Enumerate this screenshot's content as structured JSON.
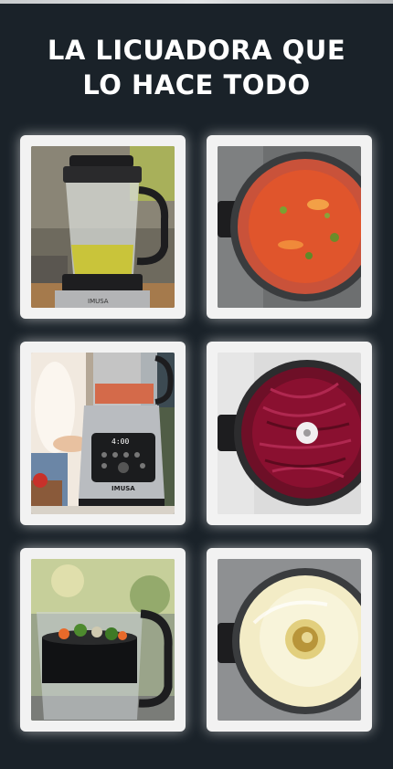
{
  "header": {
    "title_line1": "LA LICUADORA QUE",
    "title_line2": "LO HACE TODO"
  },
  "gallery": [
    {
      "name": "blender-soup-photo",
      "accent": "#c9c43a"
    },
    {
      "name": "tomato-soup-photo",
      "accent": "#e0552c"
    },
    {
      "name": "blender-control-panel-photo",
      "accent": "#b9bcc0"
    },
    {
      "name": "beet-shreds-photo",
      "accent": "#8a1030"
    },
    {
      "name": "vegetable-steamer-photo",
      "accent": "#4d8a2e"
    },
    {
      "name": "cream-sauce-photo",
      "accent": "#f3ecc6"
    }
  ],
  "product": {
    "brand_mark": "IMUSA",
    "display_readout": "4:00"
  },
  "colors": {
    "background": "#1a2229",
    "card": "#f2f2f2",
    "title": "#ffffff"
  }
}
